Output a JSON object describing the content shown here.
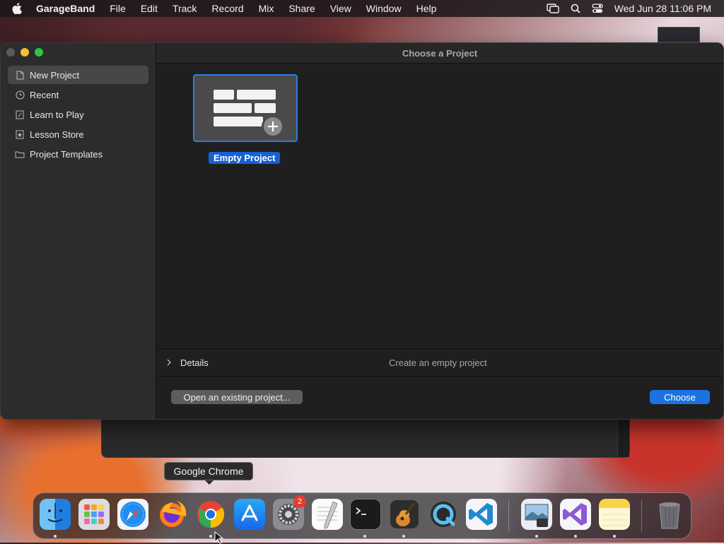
{
  "menubar": {
    "app_name": "GarageBand",
    "items": [
      "File",
      "Edit",
      "Track",
      "Record",
      "Mix",
      "Share",
      "View",
      "Window",
      "Help"
    ],
    "clock": "Wed Jun 28  11:06 PM"
  },
  "window": {
    "title": "Choose a Project",
    "sidebar": [
      {
        "label": "New Project",
        "icon": "document-icon",
        "selected": true
      },
      {
        "label": "Recent",
        "icon": "clock-icon"
      },
      {
        "label": "Learn to Play",
        "icon": "guitar-book-icon"
      },
      {
        "label": "Lesson Store",
        "icon": "star-icon"
      },
      {
        "label": "Project Templates",
        "icon": "folder-icon"
      }
    ],
    "project": {
      "label": "Empty Project"
    },
    "details": {
      "label": "Details",
      "description": "Create an empty project"
    },
    "buttons": {
      "open_existing": "Open an existing project...",
      "choose": "Choose"
    }
  },
  "tooltip": "Google Chrome",
  "dock": {
    "apps": [
      "Finder",
      "Launchpad",
      "Safari",
      "Firefox",
      "Google Chrome",
      "App Store",
      "System Settings",
      "TextEdit",
      "Terminal",
      "GarageBand",
      "QuickTime Player",
      "Visual Studio Code",
      "Preview",
      "Visual Studio",
      "Notes",
      "Trash"
    ],
    "settings_badge": "2"
  },
  "colors": {
    "accent": "#1c73e0",
    "selection": "#474747"
  }
}
